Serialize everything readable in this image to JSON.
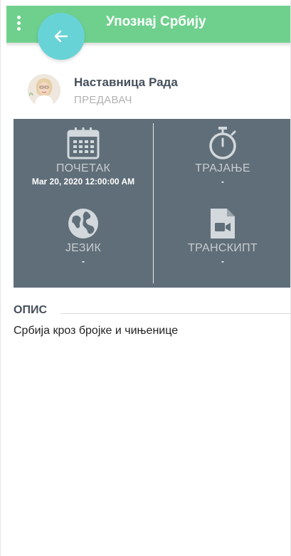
{
  "header": {
    "title": "Упознај Србију",
    "menu_icon": "kebab-menu-icon",
    "back_icon": "arrow-left-icon"
  },
  "author": {
    "name": "Наставница Рада",
    "role": "ПРЕДАВАЧ"
  },
  "info": {
    "start": {
      "label": "ПОЧЕТАК",
      "value": "Mar 20, 2020 12:00:00 AM",
      "icon": "calendar-icon"
    },
    "duration": {
      "label": "ТРАЈАЊЕ",
      "value": "-",
      "icon": "stopwatch-icon"
    },
    "language": {
      "label": "ЈЕЗИК",
      "value": "-",
      "icon": "globe-icon"
    },
    "transcript": {
      "label": "ТРАНСКИПТ",
      "value": "-",
      "icon": "video-file-icon"
    }
  },
  "description": {
    "title": "ОПИС",
    "text": "Србија кроз бројке и чињенице"
  },
  "colors": {
    "header": "#6fd08d",
    "fab": "#68d3d6",
    "panel": "#5f6e78",
    "panel_label": "#c7cdd1",
    "name": "#454f5b",
    "role": "#b1b1b1"
  }
}
